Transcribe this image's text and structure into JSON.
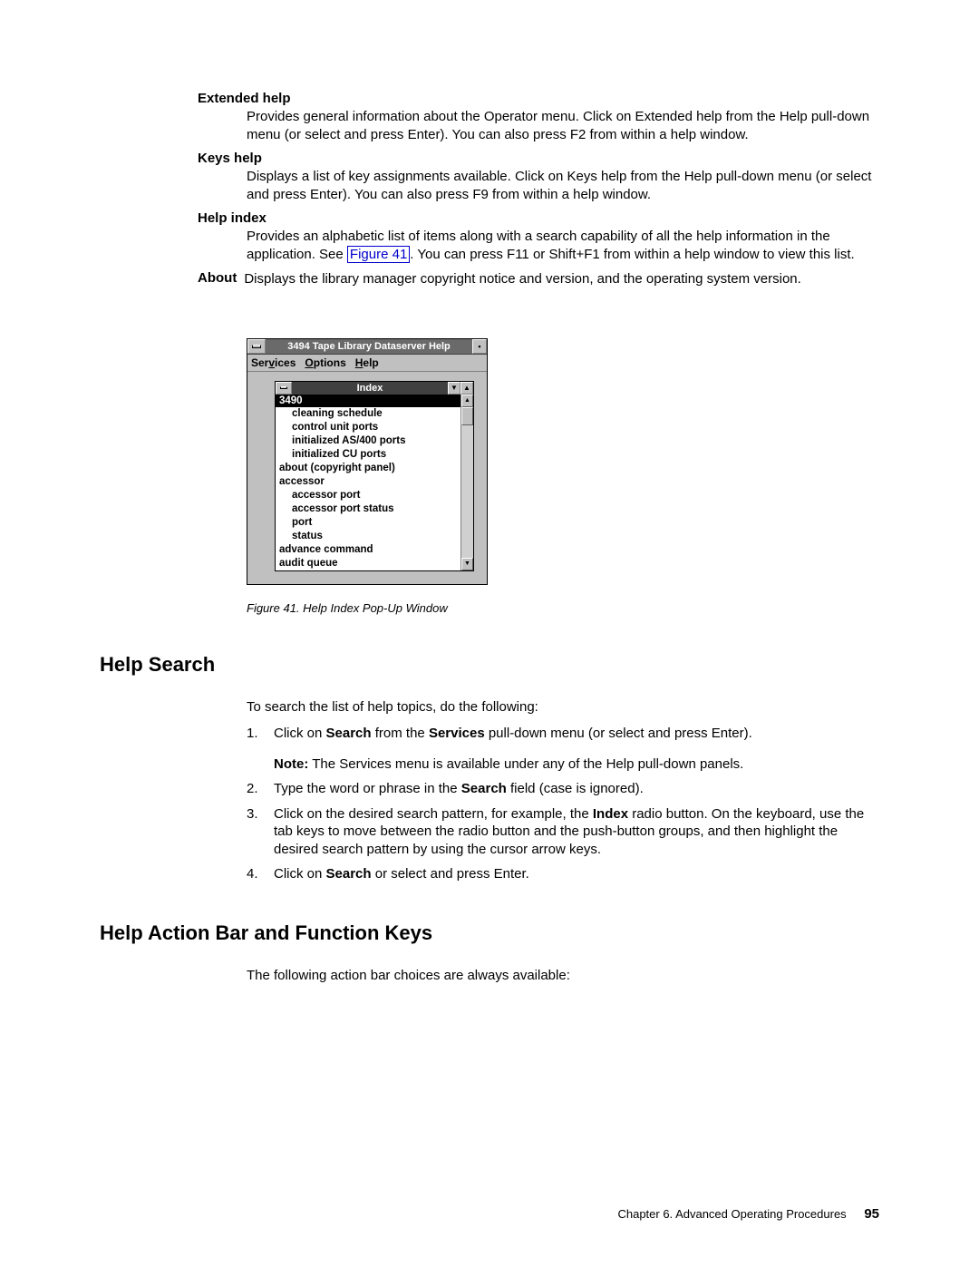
{
  "defs": {
    "extended_help": {
      "term": "Extended help",
      "desc": "Provides general information about the Operator menu. Click on Extended help from the Help pull-down menu (or select and press Enter). You can also press F2 from within a help window."
    },
    "keys_help": {
      "term": "Keys help",
      "desc": "Displays a list of key assignments available. Click on Keys help from the Help pull-down menu (or select and press Enter). You can also press F9 from within a help window."
    },
    "help_index": {
      "term": "Help index",
      "desc_pre": "Provides an alphabetic list of items along with a search capability of all the help information in the application. See ",
      "link": "Figure 41",
      "desc_post": ". You can press F11 or Shift+F1 from within a help window to view this list."
    },
    "about": {
      "term": "About",
      "desc": "Displays the library manager copyright notice and version, and the operating system version."
    }
  },
  "window": {
    "title": "3494 Tape Library Dataserver Help",
    "menubar": {
      "services": "Services",
      "services_u": "v",
      "options": "Options",
      "options_u": "O",
      "help": "Help",
      "help_u": "H"
    },
    "index_title": "Index",
    "selected": "3490",
    "items": [
      {
        "label": "cleaning schedule",
        "indent": 1
      },
      {
        "label": "control unit ports",
        "indent": 1
      },
      {
        "label": "initialized AS/400 ports",
        "indent": 1
      },
      {
        "label": "initialized CU ports",
        "indent": 1
      },
      {
        "label": "about (copyright panel)",
        "indent": 0
      },
      {
        "label": "accessor",
        "indent": 0
      },
      {
        "label": "accessor port",
        "indent": 1
      },
      {
        "label": "accessor port status",
        "indent": 1
      },
      {
        "label": "port",
        "indent": 1
      },
      {
        "label": "status",
        "indent": 1
      },
      {
        "label": "advance command",
        "indent": 0
      },
      {
        "label": "audit queue",
        "indent": 0
      }
    ]
  },
  "figure_caption": "Figure 41. Help Index Pop-Up Window",
  "help_search": {
    "heading": "Help Search",
    "intro": "To search the list of help topics, do the following:",
    "step1_pre": "Click on ",
    "step1_b1": "Search",
    "step1_mid": " from the ",
    "step1_b2": "Services",
    "step1_post": " pull-down menu (or select and press Enter).",
    "note_label": "Note:",
    "note_text": " The Services menu is available under any of the Help pull-down panels.",
    "step2_pre": "Type the word or phrase in the ",
    "step2_b": "Search",
    "step2_post": " field (case is ignored).",
    "step3_pre": "Click on the desired search pattern, for example, the ",
    "step3_b": "Index",
    "step3_post": " radio button. On the keyboard, use the tab keys to move between the radio button and the push-button groups, and then highlight the desired search pattern by using the cursor arrow keys.",
    "step4_pre": "Click on ",
    "step4_b": "Search",
    "step4_post": " or select and press Enter."
  },
  "action_bar": {
    "heading": "Help Action Bar and Function Keys",
    "intro": "The following action bar choices are always available:"
  },
  "footer": {
    "chapter": "Chapter 6. Advanced Operating Procedures",
    "page": "95"
  }
}
